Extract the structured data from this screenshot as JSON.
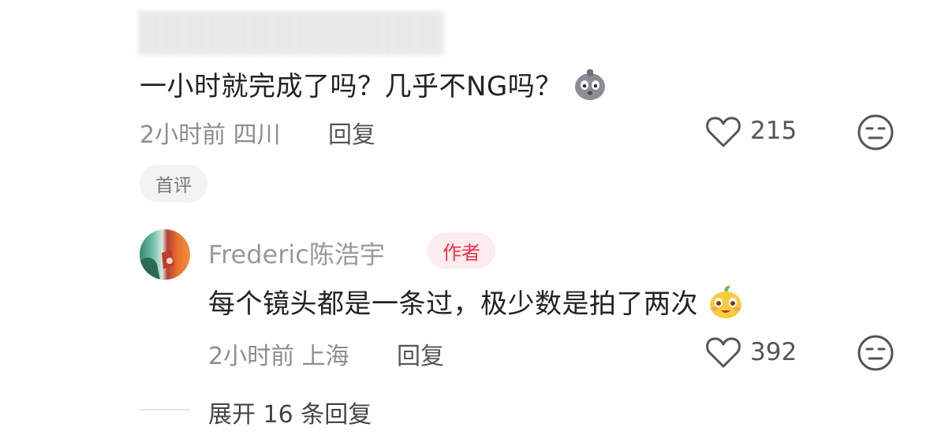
{
  "comment1": {
    "text": "一小时就完成了吗？几乎不NG吗？",
    "sticker": "shocked-face-sticker",
    "time_location": "2小时前 四川",
    "reply_label": "回复",
    "like_count": "215",
    "first_badge": "首评"
  },
  "reply1": {
    "author": "Frederic陈浩宇",
    "author_badge": "作者",
    "text": "每个镜头都是一条过，极少数是拍了两次",
    "sticker": "happy-face-sticker",
    "time_location": "2小时前 上海",
    "reply_label": "回复",
    "like_count": "392"
  },
  "expand_label": "展开 16 条回复",
  "colors": {
    "author_badge": "#e8344e",
    "meta_text": "#8d8d8d"
  }
}
